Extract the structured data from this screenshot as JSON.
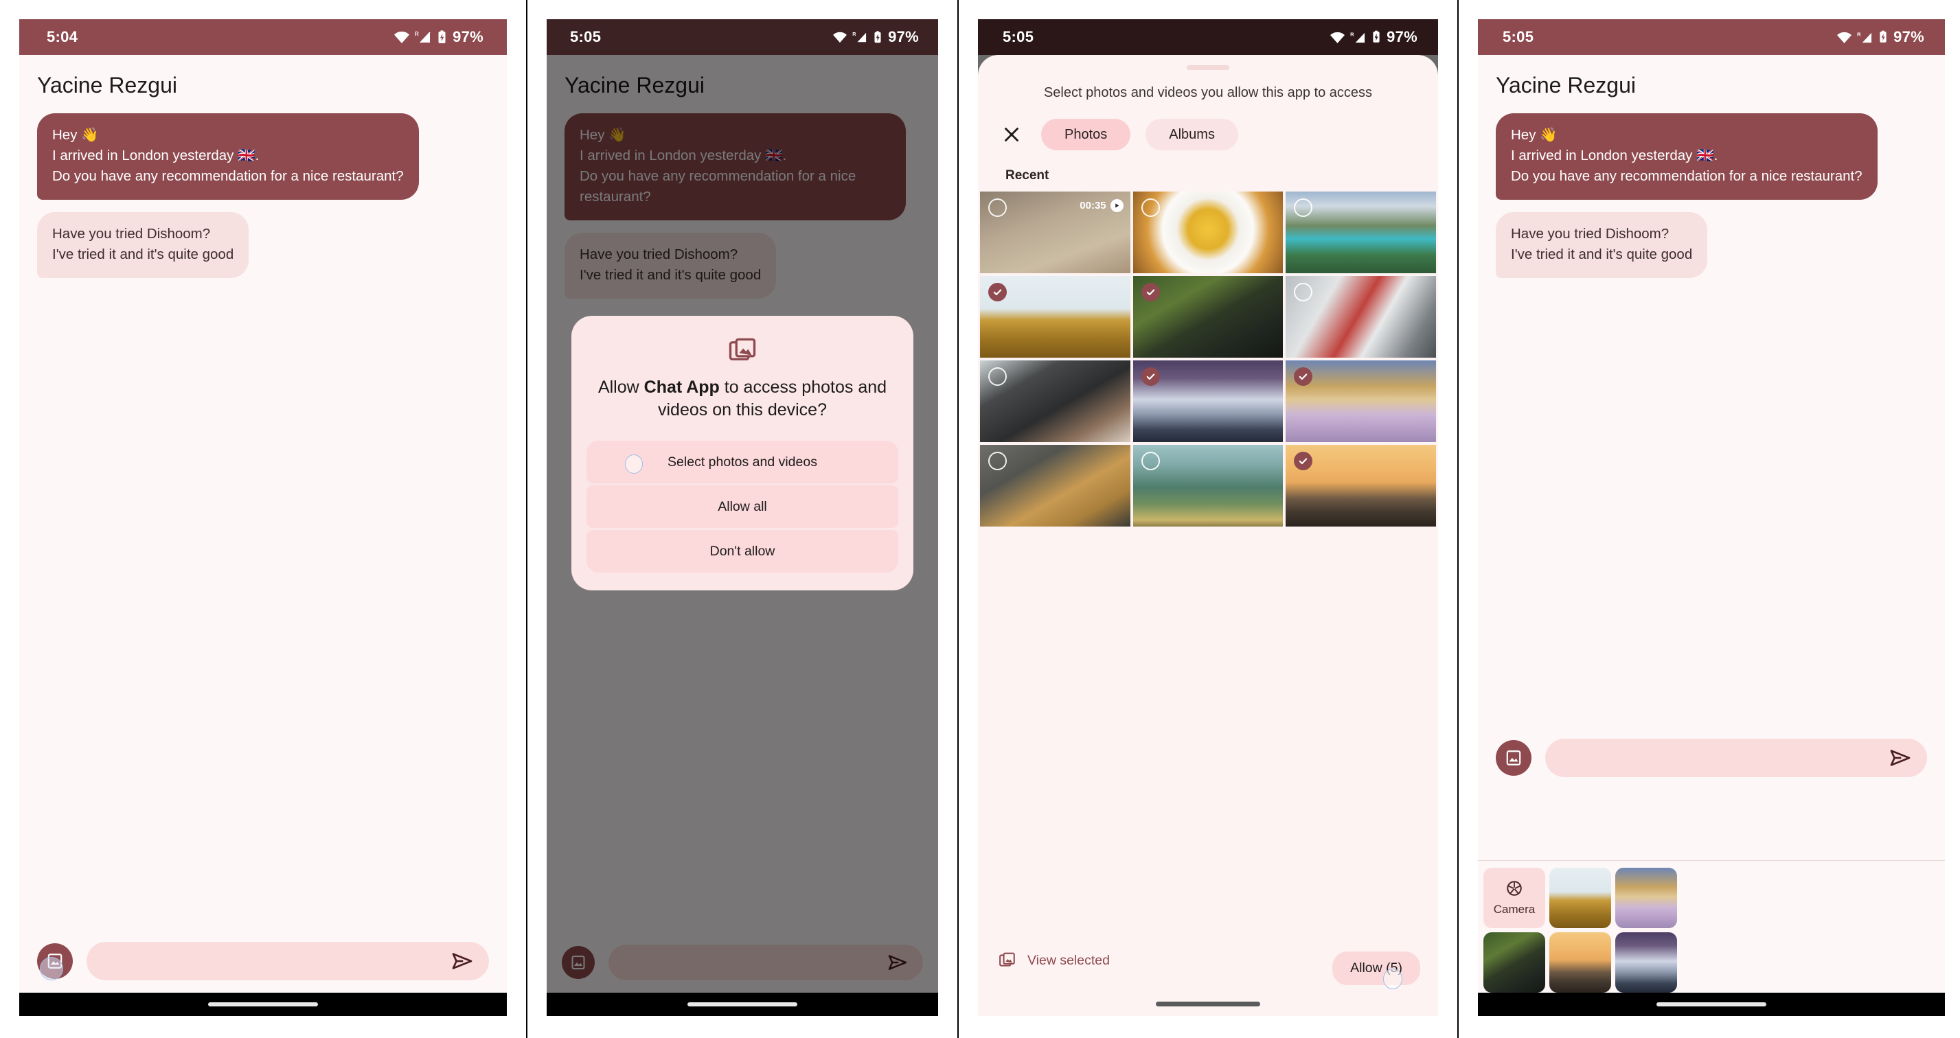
{
  "panels": [
    {
      "id": "chat-initial",
      "status": {
        "time": "5:04",
        "battery": "97%"
      },
      "chat": {
        "title": "Yacine Rezgui",
        "messages": [
          {
            "from": "them",
            "text": "Hey 👋\nI arrived in London yesterday 🇬🇧.\nDo you have any recommendation for a nice restaurant?"
          },
          {
            "from": "me",
            "text": "Have you tried Dishoom?\nI've tried it and it's quite good"
          }
        ]
      },
      "composer": {
        "attach_icon": "image-icon",
        "send_icon": "send-icon",
        "input_value": "",
        "placeholder": ""
      }
    },
    {
      "id": "permission-dialog",
      "status": {
        "time": "5:05",
        "battery": "97%"
      },
      "chat": {
        "title": "Yacine Rezgui",
        "messages": [
          {
            "from": "them",
            "text": "Hey 👋\nI arrived in London yesterday 🇬🇧.\nDo you have any recommendation for a nice restaurant?"
          },
          {
            "from": "me",
            "text": "Have you tried Dishoom?\nI've tried it and it's quite good"
          }
        ]
      },
      "dialog": {
        "icon": "photo-library-icon",
        "title_prefix": "Allow ",
        "title_app": "Chat App",
        "title_suffix": " to access photos and videos on this device?",
        "options": [
          {
            "label": "Select photos and videos",
            "pressed": true
          },
          {
            "label": "Allow all",
            "pressed": false
          },
          {
            "label": "Don't allow",
            "pressed": false
          }
        ]
      },
      "composer": {
        "attach_icon": "image-icon",
        "send_icon": "send-icon",
        "input_value": "",
        "placeholder": ""
      }
    },
    {
      "id": "photo-picker",
      "status": {
        "time": "5:05",
        "battery": "97%"
      },
      "picker": {
        "subtitle": "Select photos and videos you allow this app to access",
        "close_icon": "close-icon",
        "tabs": [
          {
            "label": "Photos",
            "active": true
          },
          {
            "label": "Albums",
            "active": false
          }
        ],
        "section_label": "Recent",
        "items": [
          {
            "name": "wooden-floor-video",
            "art": "ph-floor",
            "selected": false,
            "video": true,
            "duration": "00:35"
          },
          {
            "name": "pasta-plate",
            "art": "ph-pasta",
            "selected": false,
            "video": false,
            "duration": ""
          },
          {
            "name": "alpine-lake",
            "art": "ph-lake",
            "selected": false,
            "video": false,
            "duration": ""
          },
          {
            "name": "lone-tree-field",
            "art": "ph-field",
            "selected": true,
            "video": false,
            "duration": ""
          },
          {
            "name": "couple-garden",
            "art": "ph-couple",
            "selected": true,
            "video": false,
            "duration": ""
          },
          {
            "name": "tube-platform",
            "art": "ph-tube",
            "selected": false,
            "video": false,
            "duration": ""
          },
          {
            "name": "cabin-woman",
            "art": "ph-cabin",
            "selected": false,
            "video": false,
            "duration": ""
          },
          {
            "name": "snowy-mountain",
            "art": "ph-mount",
            "selected": true,
            "video": false,
            "duration": ""
          },
          {
            "name": "winter-city",
            "art": "ph-city",
            "selected": true,
            "video": false,
            "duration": ""
          },
          {
            "name": "man-sunglasses",
            "art": "ph-man",
            "selected": false,
            "video": false,
            "duration": ""
          },
          {
            "name": "misty-forest",
            "art": "ph-forest",
            "selected": false,
            "video": false,
            "duration": ""
          },
          {
            "name": "suv-sunset",
            "art": "ph-car",
            "selected": true,
            "video": false,
            "duration": ""
          }
        ],
        "footer": {
          "view_selected_label": "View selected",
          "view_selected_icon": "photo-library-icon",
          "allow_label": "Allow (5)",
          "selected_count": 5
        }
      }
    },
    {
      "id": "chat-with-tray",
      "status": {
        "time": "5:05",
        "battery": "97%"
      },
      "chat": {
        "title": "Yacine Rezgui",
        "messages": [
          {
            "from": "them",
            "text": "Hey 👋\nI arrived in London yesterday 🇬🇧.\nDo you have any recommendation for a nice restaurant?"
          },
          {
            "from": "me",
            "text": "Have you tried Dishoom?\nI've tried it and it's quite good"
          }
        ]
      },
      "composer": {
        "attach_icon": "image-icon",
        "send_icon": "send-icon",
        "input_value": "",
        "placeholder": ""
      },
      "tray": {
        "camera_label": "Camera",
        "camera_icon": "camera-aperture-icon",
        "items": [
          {
            "name": "lone-tree-field",
            "art": "ph-field"
          },
          {
            "name": "winter-city",
            "art": "ph-city"
          },
          {
            "name": "couple-garden",
            "art": "ph-couple"
          },
          {
            "name": "suv-sunset",
            "art": "ph-car"
          },
          {
            "name": "snowy-mountain",
            "art": "ph-mount"
          }
        ]
      }
    }
  ],
  "theme": {
    "primary": "#8e4a4f",
    "surface": "#fdf7f8",
    "bubble_in": "#f6e0e0",
    "accent_light": "#fbdcdc",
    "statusbar_dark": "#2b1718",
    "statusbar_dim": "#3d2224"
  },
  "status_icons": {
    "wifi": "wifi-icon",
    "signal": "cellular-roaming-icon",
    "battery": "battery-charging-icon"
  }
}
